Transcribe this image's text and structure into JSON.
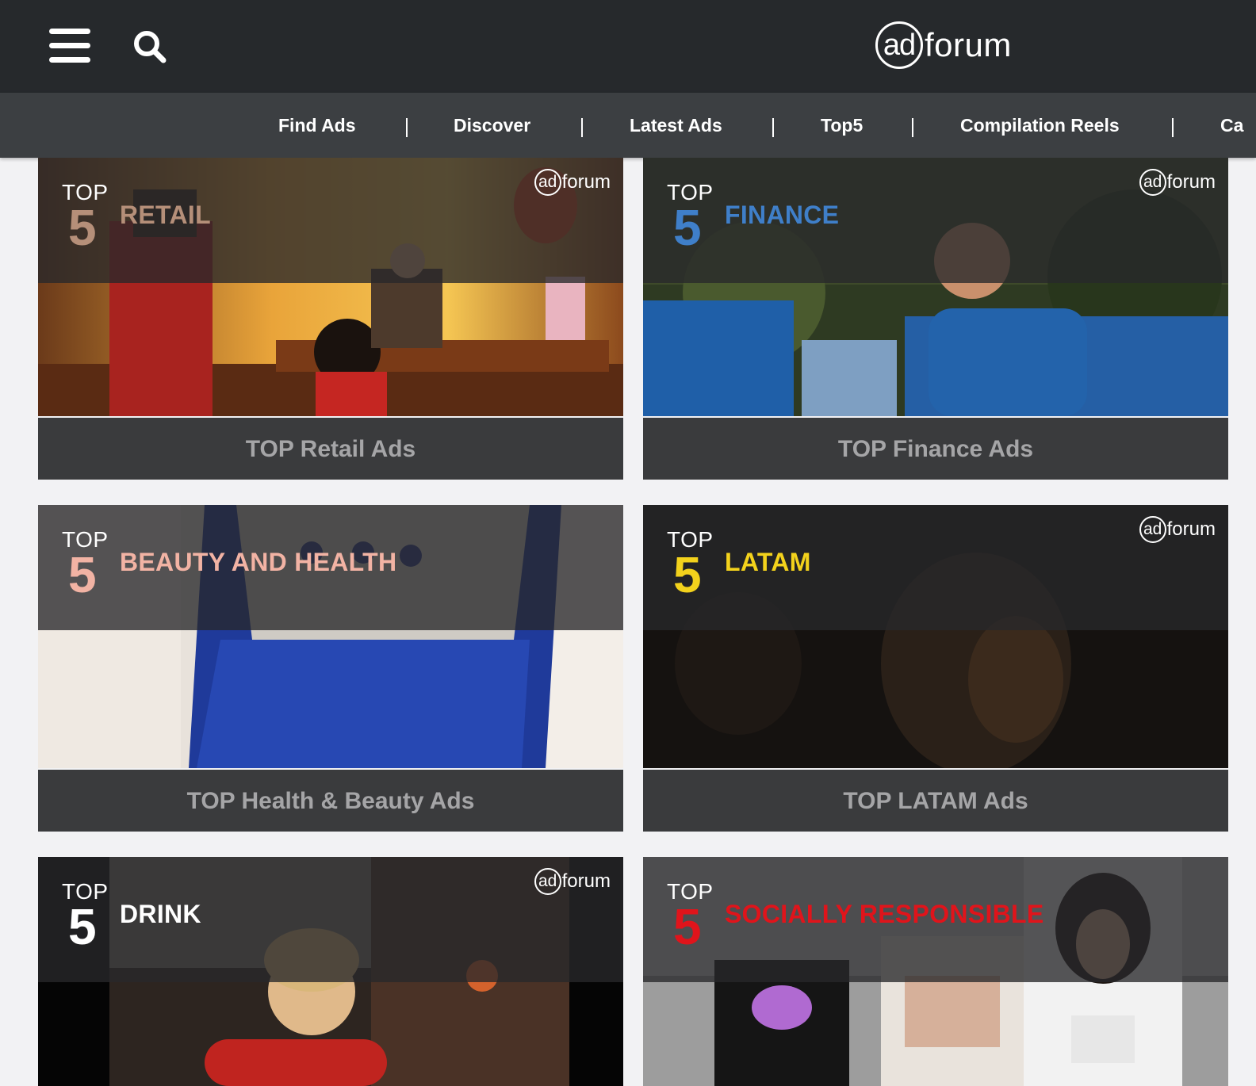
{
  "header": {
    "logo_ad": "ad",
    "logo_forum": "forum"
  },
  "nav": {
    "items": [
      "Find Ads",
      "Discover",
      "Latest Ads",
      "Top5",
      "Compilation Reels",
      "Ca"
    ],
    "separator": "|"
  },
  "cards": [
    {
      "top": "TOP",
      "number": "5",
      "category": "RETAIL",
      "accent": "#b58f79",
      "caption": "TOP Retail Ads"
    },
    {
      "top": "TOP",
      "number": "5",
      "category": "FINANCE",
      "accent": "#3f7fc9",
      "caption": "TOP Finance Ads"
    },
    {
      "top": "TOP",
      "number": "5",
      "category": "BEAUTY AND HEALTH",
      "accent": "#f2b3a4",
      "caption": "TOP Health & Beauty Ads"
    },
    {
      "top": "TOP",
      "number": "5",
      "category": "LATAM",
      "accent": "#f3d21c",
      "caption": "TOP LATAM Ads"
    },
    {
      "top": "TOP",
      "number": "5",
      "category": "DRINK",
      "accent": "#ffffff",
      "caption": ""
    },
    {
      "top": "TOP",
      "number": "5",
      "category": "SOCIALLY RESPONSIBLE",
      "accent": "#e0141b",
      "caption": ""
    }
  ],
  "card_logo": {
    "ad": "ad",
    "forum": "forum"
  },
  "colors": {
    "topbar_bg": "#26292c",
    "navbar_bg": "#3c3f42",
    "page_bg": "#f2f2f4",
    "card_caption_bg": "#3a3b3d",
    "caption_text": "#a5a5a7"
  }
}
